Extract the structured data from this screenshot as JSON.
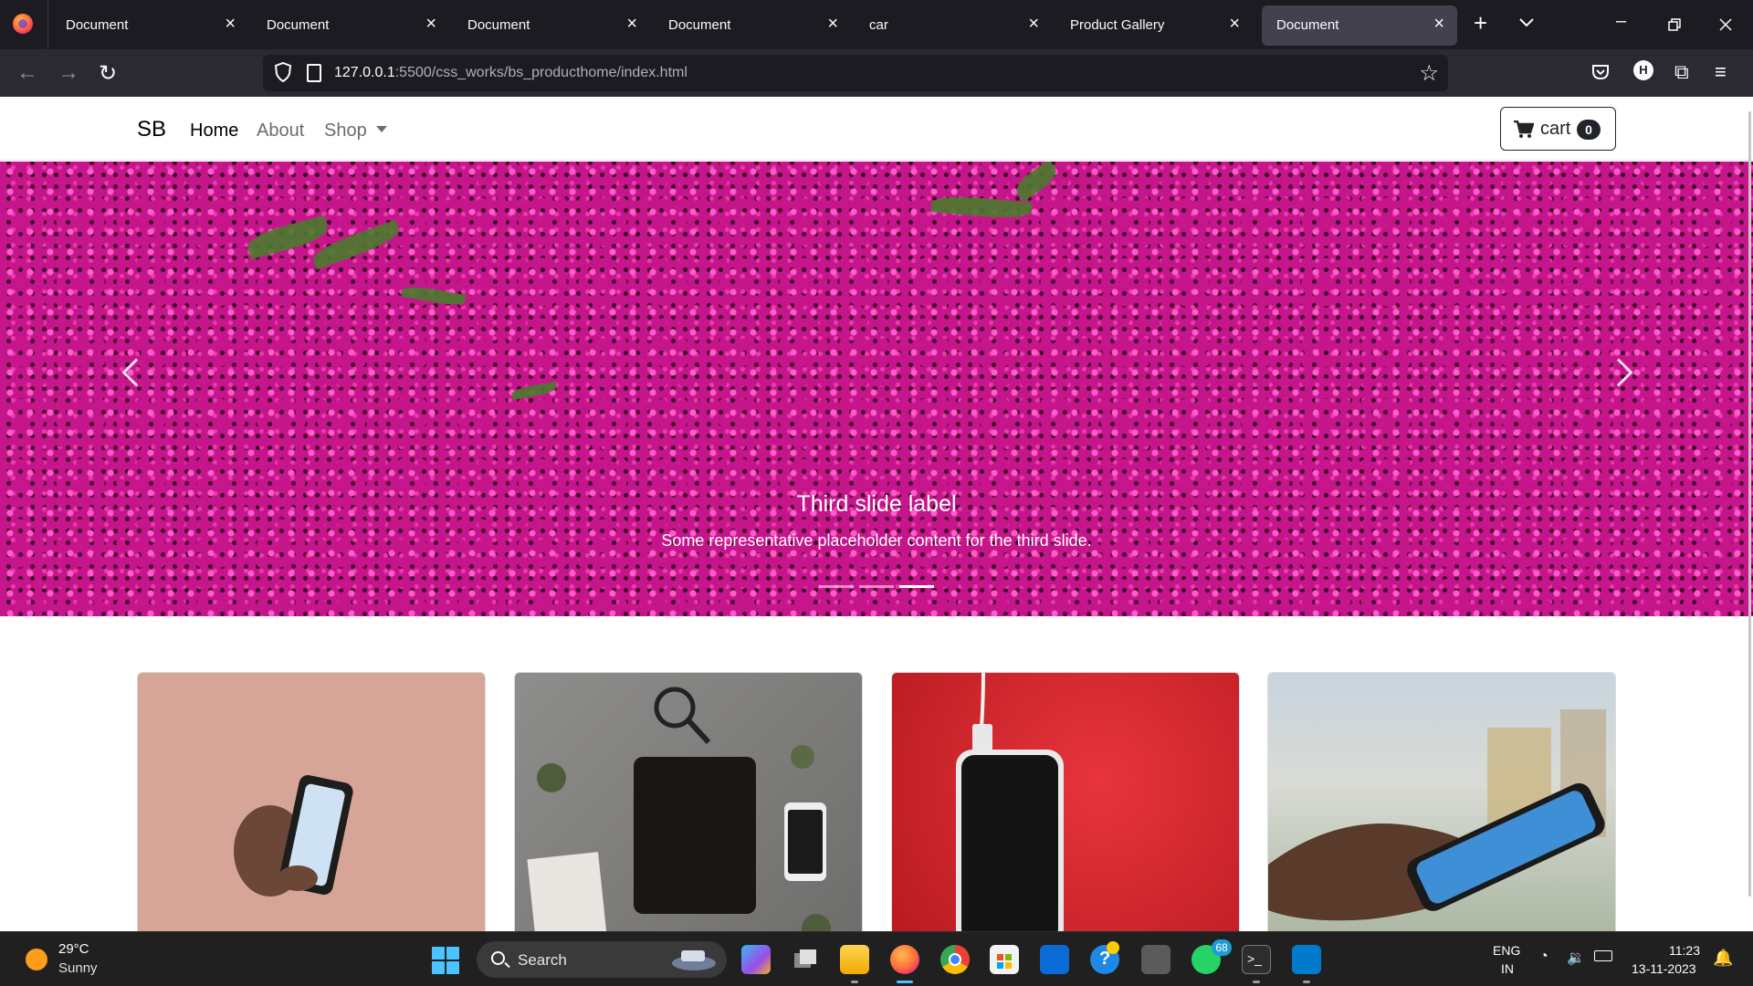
{
  "browser": {
    "tabs": [
      {
        "title": "Document",
        "active": false
      },
      {
        "title": "Document",
        "active": false
      },
      {
        "title": "Document",
        "active": false
      },
      {
        "title": "Document",
        "active": false
      },
      {
        "title": "car",
        "active": false
      },
      {
        "title": "Product Gallery",
        "active": false
      },
      {
        "title": "Document",
        "active": true
      }
    ],
    "url_host": "127.0.0.1",
    "url_path": ":5500/css_works/bs_producthome/index.html",
    "profile_initial": "H"
  },
  "site": {
    "brand": "SB",
    "nav": [
      {
        "label": "Home",
        "active": true
      },
      {
        "label": "About",
        "active": false
      },
      {
        "label": "Shop",
        "active": false,
        "dropdown": true
      }
    ],
    "cart_label": "cart",
    "cart_count": "0"
  },
  "carousel": {
    "caption_title": "Third slide label",
    "caption_text": "Some representative placeholder content for the third slide.",
    "slide_count": 3,
    "active_slide": 3
  },
  "taskbar": {
    "weather_temp": "29°C",
    "weather_condition": "Sunny",
    "search_placeholder": "Search",
    "whatsapp_badge": "68",
    "lang_primary": "ENG",
    "lang_secondary": "IN",
    "time": "11:23",
    "date": "13-11-2023"
  },
  "colors": {
    "tabbar_bg": "#1c1b22",
    "toolbar_bg": "#2b2a33",
    "taskbar_bg": "#202020",
    "accent": "#4cc2ff"
  }
}
